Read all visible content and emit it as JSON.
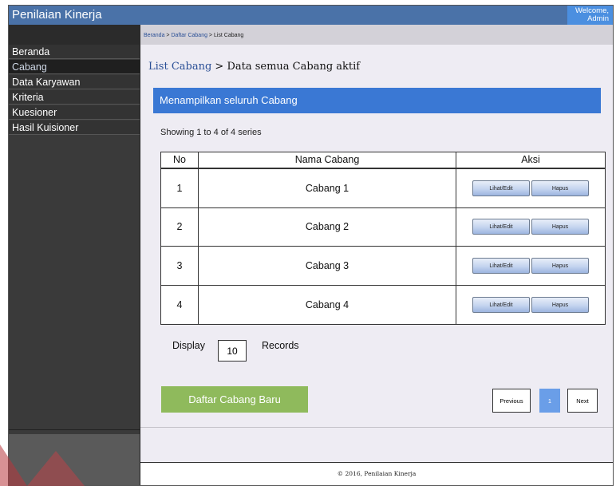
{
  "app": {
    "title": "Penilaian Kinerja",
    "welcome_line1": "Welcome,",
    "welcome_line2": "Admin"
  },
  "sidebar": {
    "items": [
      {
        "label": "Beranda"
      },
      {
        "label": "Cabang"
      },
      {
        "label": "Data Karyawan"
      },
      {
        "label": "Kriteria"
      },
      {
        "label": "Kuesioner"
      },
      {
        "label": "Hasil Kuisioner"
      }
    ],
    "active_index": 1
  },
  "breadcrumb": {
    "link1": "Beranda",
    "sep1": " > ",
    "link2": "Daftar Cabang",
    "sep2": " > ",
    "current": "List Cabang"
  },
  "page": {
    "title_link": "List Cabang",
    "title_rest": " > Data semua Cabang aktif"
  },
  "banner": {
    "text": "Menampilkan seluruh Cabang"
  },
  "table": {
    "showing": "Showing 1 to 4 of 4 series",
    "headers": {
      "no": "No",
      "name": "Nama Cabang",
      "action": "Aksi"
    },
    "rows": [
      {
        "no": "1",
        "name": "Cabang 1"
      },
      {
        "no": "2",
        "name": "Cabang 2"
      },
      {
        "no": "3",
        "name": "Cabang 3"
      },
      {
        "no": "4",
        "name": "Cabang 4"
      }
    ],
    "edit_label": "Lihat/Edit",
    "delete_label": "Hapus"
  },
  "records": {
    "display_label": "Display",
    "value": "10",
    "records_label": "Records"
  },
  "actions": {
    "new_branch": "Daftar Cabang Baru"
  },
  "pagination": {
    "prev": "Previous",
    "current": "1",
    "next": "Next"
  },
  "footer": {
    "text": "© 2016, Penilaian Kinerja"
  },
  "colors": {
    "header": "#4a72a8",
    "welcome": "#4b8fe0",
    "banner": "#3a78d4",
    "sidebar": "#3a3a3a",
    "new_button": "#8fba5c",
    "active_page": "#6a9ee8"
  }
}
